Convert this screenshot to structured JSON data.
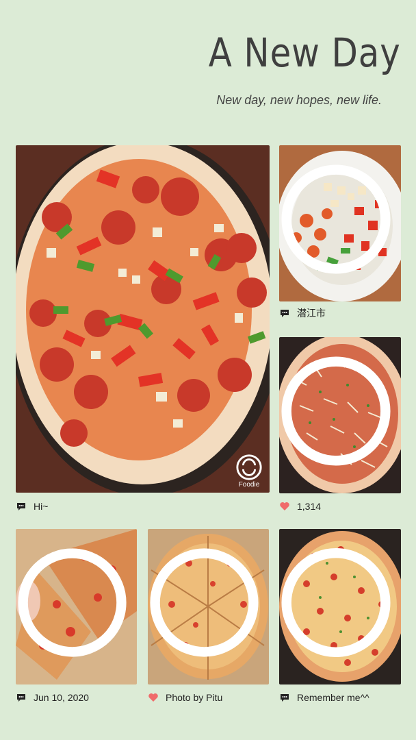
{
  "header": {
    "title": "A New Day",
    "subtitle": "New day, new hopes, new life."
  },
  "photos": {
    "main": {
      "watermark": "Foodie"
    }
  },
  "captions": {
    "top_right": {
      "icon": "speech-bubble-icon",
      "text": "潜江市"
    },
    "main": {
      "icon": "speech-bubble-icon",
      "text": "Hi~"
    },
    "middle_right": {
      "icon": "heart-icon",
      "text": "1,314"
    },
    "bottom_left": {
      "icon": "speech-bubble-icon",
      "text": "Jun 10, 2020"
    },
    "bottom_middle": {
      "icon": "heart-icon",
      "text": "Photo by Pitu"
    },
    "bottom_right": {
      "icon": "speech-bubble-icon",
      "text": "Remember me^^"
    }
  },
  "colors": {
    "background": "#dcebd6",
    "heart": "#f06b6b",
    "text": "#222222"
  }
}
